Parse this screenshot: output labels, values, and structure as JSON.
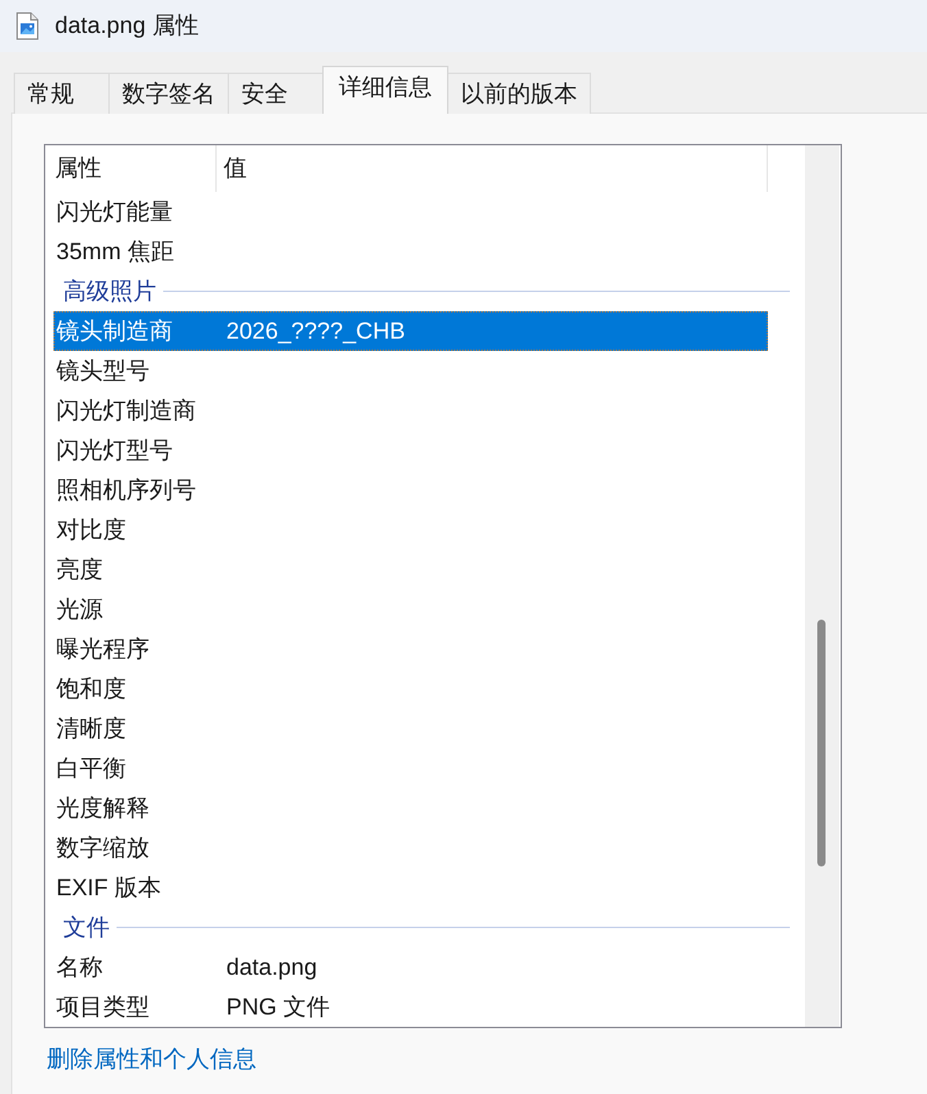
{
  "window": {
    "title": "data.png 属性"
  },
  "tabs": [
    {
      "label": "常规",
      "selected": false
    },
    {
      "label": "数字签名",
      "selected": false
    },
    {
      "label": "安全",
      "selected": false
    },
    {
      "label": "详细信息",
      "selected": true
    },
    {
      "label": "以前的版本",
      "selected": false
    }
  ],
  "details": {
    "columns": [
      "属性",
      "值"
    ],
    "sections": [
      {
        "properties": [
          {
            "name": "闪光灯能量",
            "selected": false
          },
          {
            "name": "35mm 焦距",
            "selected": false
          }
        ]
      },
      {
        "title": "高级照片",
        "properties": [
          {
            "name": "镜头制造商",
            "value": "2026_????_CHB",
            "selected": true
          },
          {
            "name": "镜头型号",
            "selected": false
          },
          {
            "name": "闪光灯制造商",
            "selected": false
          },
          {
            "name": "闪光灯型号",
            "selected": false
          },
          {
            "name": "照相机序列号",
            "selected": false
          },
          {
            "name": "对比度",
            "selected": false
          },
          {
            "name": "亮度",
            "selected": false
          },
          {
            "name": "光源",
            "selected": false
          },
          {
            "name": "曝光程序",
            "selected": false
          },
          {
            "name": "饱和度",
            "selected": false
          },
          {
            "name": "清晰度",
            "selected": false
          },
          {
            "name": "白平衡",
            "selected": false
          },
          {
            "name": "光度解释",
            "selected": false
          },
          {
            "name": "数字缩放",
            "selected": false
          },
          {
            "name": "EXIF 版本",
            "selected": false
          }
        ]
      },
      {
        "title": "文件",
        "properties": [
          {
            "name": "名称",
            "value": "data.png",
            "selected": false
          },
          {
            "name": "项目类型",
            "value": "PNG 文件",
            "selected": false
          }
        ]
      }
    ]
  },
  "remove_link": "删除属性和个人信息"
}
